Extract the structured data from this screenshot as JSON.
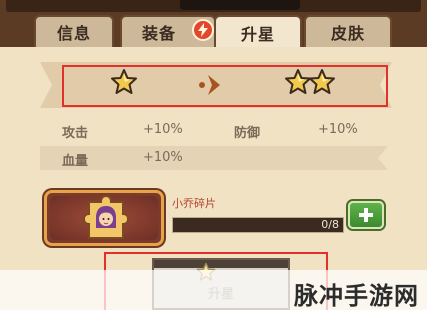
{
  "tabs": [
    {
      "label": "信息"
    },
    {
      "label": "装备"
    },
    {
      "label": "升星"
    },
    {
      "label": "皮肤"
    }
  ],
  "active_tab": "升星",
  "star_upgrade": {
    "from_stars": 1,
    "to_stars": 2
  },
  "stats": {
    "attack_label": "攻击",
    "attack_value": "+10%",
    "defense_label": "防御",
    "defense_value": "+10%",
    "hp_label": "血量",
    "hp_value": "+10%"
  },
  "shard": {
    "label": "小乔碎片",
    "progress_text": "0/8",
    "current": 0,
    "total": 8
  },
  "upgrade_button": {
    "label": "升星"
  },
  "watermark": {
    "text": "脉冲手游网"
  },
  "colors": {
    "accent_red": "#e4302b",
    "gold": "#f2c94c",
    "green_button": "#4a9e3a",
    "brown": "#5b3b24"
  }
}
